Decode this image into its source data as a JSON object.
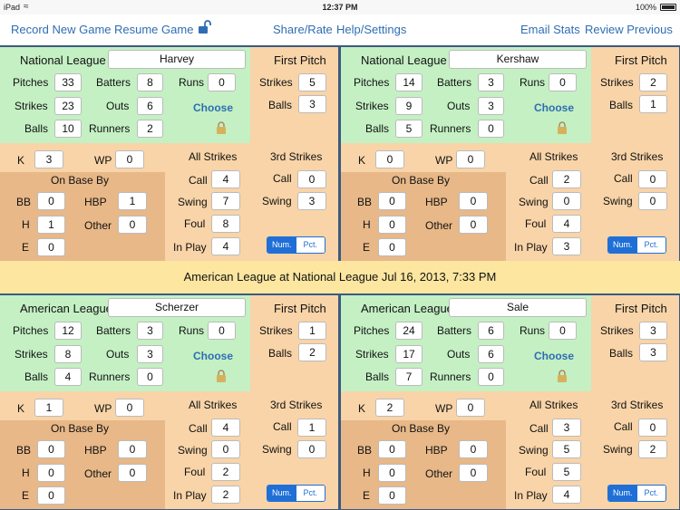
{
  "status_bar": {
    "carrier": "iPad",
    "time": "12:37 PM",
    "battery": "100%"
  },
  "toolbar": {
    "record_new_game": "Record New Game",
    "resume_game": "Resume Game",
    "share_rate": "Share/Rate",
    "help_settings": "Help/Settings",
    "email_stats": "Email Stats",
    "review_previous": "Review Previous"
  },
  "labels": {
    "pitches": "Pitches",
    "strikes": "Strikes",
    "balls": "Balls",
    "batters": "Batters",
    "outs": "Outs",
    "runners": "Runners",
    "runs": "Runs",
    "choose": "Choose",
    "first_pitch": "First Pitch",
    "k": "K",
    "wp": "WP",
    "on_base_by": "On Base By",
    "bb": "BB",
    "hbp": "HBP",
    "h": "H",
    "other": "Other",
    "e": "E",
    "all_strikes": "All Strikes",
    "call": "Call",
    "swing": "Swing",
    "foul": "Foul",
    "in_play": "In Play",
    "third_strikes": "3rd Strikes",
    "num": "Num.",
    "pct": "Pct."
  },
  "game_banner": "American League at National League Jul 16, 2013, 7:33 PM",
  "panels": [
    {
      "league": "National League",
      "pitcher": "Harvey",
      "pitches": "33",
      "strikes": "23",
      "balls": "10",
      "batters": "8",
      "outs": "6",
      "runners": "2",
      "runs": "0",
      "fp_strikes": "5",
      "fp_balls": "3",
      "k": "3",
      "wp": "0",
      "bb": "0",
      "hbp": "1",
      "h": "1",
      "other": "0",
      "e": "0",
      "call": "4",
      "swing": "7",
      "foul": "8",
      "in_play": "4",
      "ts_call": "0",
      "ts_swing": "3"
    },
    {
      "league": "National League",
      "pitcher": "Kershaw",
      "pitches": "14",
      "strikes": "9",
      "balls": "5",
      "batters": "3",
      "outs": "3",
      "runners": "0",
      "runs": "0",
      "fp_strikes": "2",
      "fp_balls": "1",
      "k": "0",
      "wp": "0",
      "bb": "0",
      "hbp": "0",
      "h": "0",
      "other": "0",
      "e": "0",
      "call": "2",
      "swing": "0",
      "foul": "4",
      "in_play": "3",
      "ts_call": "0",
      "ts_swing": "0"
    },
    {
      "league": "American League",
      "pitcher": "Scherzer",
      "pitches": "12",
      "strikes": "8",
      "balls": "4",
      "batters": "3",
      "outs": "3",
      "runners": "0",
      "runs": "0",
      "fp_strikes": "1",
      "fp_balls": "2",
      "k": "1",
      "wp": "0",
      "bb": "0",
      "hbp": "0",
      "h": "0",
      "other": "0",
      "e": "0",
      "call": "4",
      "swing": "0",
      "foul": "2",
      "in_play": "2",
      "ts_call": "1",
      "ts_swing": "0"
    },
    {
      "league": "American League",
      "pitcher": "Sale",
      "pitches": "24",
      "strikes": "17",
      "balls": "7",
      "batters": "6",
      "outs": "6",
      "runners": "0",
      "runs": "0",
      "fp_strikes": "3",
      "fp_balls": "3",
      "k": "2",
      "wp": "0",
      "bb": "0",
      "hbp": "0",
      "h": "0",
      "other": "0",
      "e": "0",
      "call": "3",
      "swing": "5",
      "foul": "5",
      "in_play": "4",
      "ts_call": "0",
      "ts_swing": "2"
    }
  ],
  "colors": {
    "accent": "#2f6db3",
    "green": "#c4f0c4",
    "peach": "#f8d4a8",
    "tan": "#e8b888",
    "banner": "#fce6a0",
    "segment": "#1f6fd6"
  }
}
